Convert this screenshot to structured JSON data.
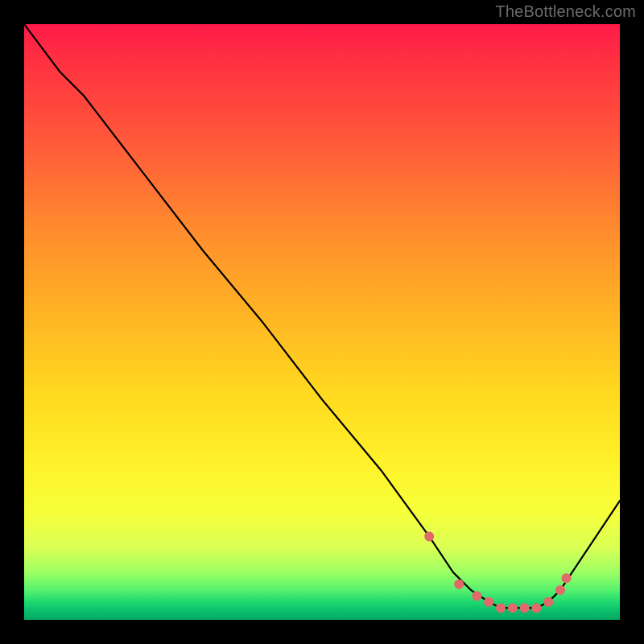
{
  "watermark": "TheBottleneck.com",
  "chart_data": {
    "type": "line",
    "title": "",
    "xlabel": "",
    "ylabel": "",
    "xlim": [
      0,
      100
    ],
    "ylim": [
      0,
      100
    ],
    "grid": false,
    "series": [
      {
        "name": "curve",
        "color": "#000000",
        "x": [
          0,
          6,
          10,
          20,
          30,
          40,
          50,
          60,
          68,
          72,
          75,
          78,
          80,
          82,
          84,
          86,
          88,
          90,
          100
        ],
        "y": [
          100,
          92,
          88,
          75,
          62,
          50,
          37,
          25,
          14,
          8,
          5,
          3,
          2,
          2,
          2,
          2,
          3,
          5,
          20
        ]
      }
    ],
    "markers": {
      "name": "dots",
      "color": "#e06a6a",
      "x": [
        68,
        73,
        76,
        78,
        80,
        82,
        84,
        86,
        88,
        90,
        91
      ],
      "y": [
        14,
        6,
        4,
        3,
        2,
        2,
        2,
        2,
        3,
        5,
        7
      ]
    }
  }
}
